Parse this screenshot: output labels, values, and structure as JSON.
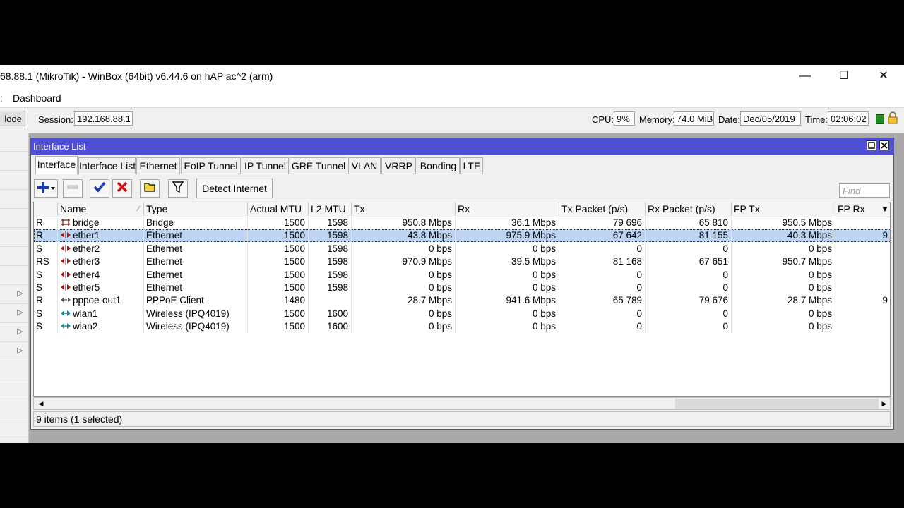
{
  "window": {
    "title": "68.88.1 (MikroTik) - WinBox (64bit) v6.44.6 on hAP ac^2 (arm)",
    "minimize_glyph": "—",
    "maximize_glyph": "☐",
    "close_glyph": "✕"
  },
  "menu": {
    "dashboard": "Dashboard"
  },
  "toolbar": {
    "mode_button": "lode",
    "session_label": "Session:",
    "session_value": "192.168.88.1",
    "cpu_label": "CPU:",
    "cpu_value": "9%",
    "memory_label": "Memory:",
    "memory_value": "74.0 MiB",
    "date_label": "Date:",
    "date_value": "Dec/05/2019",
    "time_label": "Time:",
    "time_value": "02:06:02"
  },
  "panel": {
    "title": "Interface List",
    "tabs": [
      "Interface",
      "Interface List",
      "Ethernet",
      "EoIP Tunnel",
      "IP Tunnel",
      "GRE Tunnel",
      "VLAN",
      "VRRP",
      "Bonding",
      "LTE"
    ],
    "active_tab": "Interface",
    "detect_button": "Detect Internet",
    "find_placeholder": "Find",
    "columns": [
      "",
      "Name",
      "Type",
      "Actual MTU",
      "L2 MTU",
      "Tx",
      "Rx",
      "Tx Packet (p/s)",
      "Rx Packet (p/s)",
      "FP Tx",
      "FP Rx"
    ],
    "rows": [
      {
        "flag": "R",
        "icon": "bridge",
        "name": "bridge",
        "type": "Bridge",
        "mtu": "1500",
        "l2mtu": "1598",
        "tx": "950.8 Mbps",
        "rx": "36.1 Mbps",
        "txp": "79 696",
        "rxp": "65 810",
        "fptx": "950.5 Mbps",
        "fprx": ""
      },
      {
        "flag": "R",
        "icon": "ethernet",
        "name": "ether1",
        "type": "Ethernet",
        "mtu": "1500",
        "l2mtu": "1598",
        "tx": "43.8 Mbps",
        "rx": "975.9 Mbps",
        "txp": "67 642",
        "rxp": "81 155",
        "fptx": "40.3 Mbps",
        "fprx": "9"
      },
      {
        "flag": "S",
        "icon": "ethernet",
        "name": "ether2",
        "type": "Ethernet",
        "mtu": "1500",
        "l2mtu": "1598",
        "tx": "0 bps",
        "rx": "0 bps",
        "txp": "0",
        "rxp": "0",
        "fptx": "0 bps",
        "fprx": ""
      },
      {
        "flag": "RS",
        "icon": "ethernet",
        "name": "ether3",
        "type": "Ethernet",
        "mtu": "1500",
        "l2mtu": "1598",
        "tx": "970.9 Mbps",
        "rx": "39.5 Mbps",
        "txp": "81 168",
        "rxp": "67 651",
        "fptx": "950.7 Mbps",
        "fprx": ""
      },
      {
        "flag": "S",
        "icon": "ethernet",
        "name": "ether4",
        "type": "Ethernet",
        "mtu": "1500",
        "l2mtu": "1598",
        "tx": "0 bps",
        "rx": "0 bps",
        "txp": "0",
        "rxp": "0",
        "fptx": "0 bps",
        "fprx": ""
      },
      {
        "flag": "S",
        "icon": "ethernet",
        "name": "ether5",
        "type": "Ethernet",
        "mtu": "1500",
        "l2mtu": "1598",
        "tx": "0 bps",
        "rx": "0 bps",
        "txp": "0",
        "rxp": "0",
        "fptx": "0 bps",
        "fprx": ""
      },
      {
        "flag": "R",
        "icon": "pppoe",
        "name": "pppoe-out1",
        "type": "PPPoE Client",
        "mtu": "1480",
        "l2mtu": "",
        "tx": "28.7 Mbps",
        "rx": "941.6 Mbps",
        "txp": "65 789",
        "rxp": "79 676",
        "fptx": "28.7 Mbps",
        "fprx": "9"
      },
      {
        "flag": "S",
        "icon": "wireless",
        "name": "wlan1",
        "type": "Wireless (IPQ4019)",
        "mtu": "1500",
        "l2mtu": "1600",
        "tx": "0 bps",
        "rx": "0 bps",
        "txp": "0",
        "rxp": "0",
        "fptx": "0 bps",
        "fprx": ""
      },
      {
        "flag": "S",
        "icon": "wireless",
        "name": "wlan2",
        "type": "Wireless (IPQ4019)",
        "mtu": "1500",
        "l2mtu": "1600",
        "tx": "0 bps",
        "rx": "0 bps",
        "txp": "0",
        "rxp": "0",
        "fptx": "0 bps",
        "fprx": ""
      }
    ],
    "selected_row": 1,
    "status": "9 items (1 selected)"
  },
  "colors": {
    "panel_title_bg": "#4f4fd6",
    "selection_bg": "#bcd4f2",
    "add_icon": "#1a3ab8",
    "check_icon": "#1a3ab8",
    "remove_icon": "#d01010",
    "ethernet_icon": "#a01818",
    "wireless_icon": "#1a8a8a"
  }
}
